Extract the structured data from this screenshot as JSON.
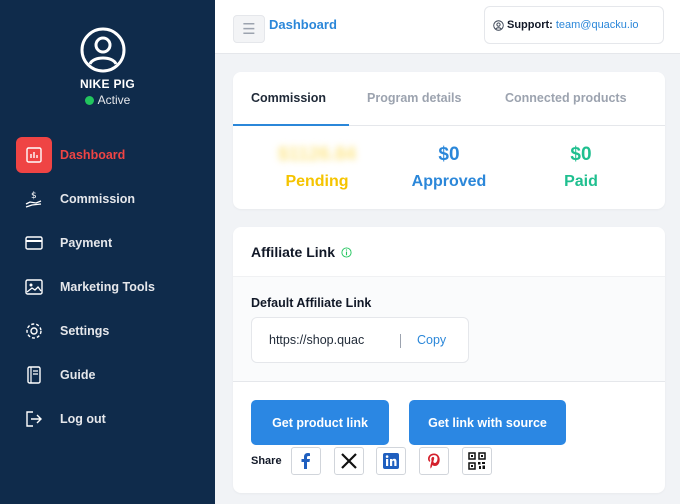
{
  "user": {
    "name": "NIKE PIG",
    "status": "Active"
  },
  "nav": [
    {
      "label": "Dashboard",
      "icon": "chart-bar-icon",
      "active": true
    },
    {
      "label": "Commission",
      "icon": "money-hand-icon"
    },
    {
      "label": "Payment",
      "icon": "credit-card-icon"
    },
    {
      "label": "Marketing Tools",
      "icon": "image-icon"
    },
    {
      "label": "Settings",
      "icon": "gear-icon"
    },
    {
      "label": "Guide",
      "icon": "book-icon"
    },
    {
      "label": "Log out",
      "icon": "logout-icon"
    }
  ],
  "topbar": {
    "title": "Dashboard",
    "menu_icon": "hamburger-icon",
    "support_label": "Support:",
    "support_email": "team@quacku.io"
  },
  "tabs": [
    {
      "label": "Commission",
      "active": true
    },
    {
      "label": "Program details"
    },
    {
      "label": "Connected products"
    }
  ],
  "stats": [
    {
      "value": "$1126.84",
      "label": "Pending",
      "color": "#f5c400",
      "blurred": true
    },
    {
      "value": "$0",
      "label": "Approved",
      "color": "#2b87d9"
    },
    {
      "value": "$0",
      "label": "Paid",
      "color": "#1fbf8f"
    }
  ],
  "affiliate": {
    "title": "Affiliate Link",
    "default_label": "Default Affiliate Link",
    "url": "https://shop.quac",
    "copy_label": "Copy",
    "buttons": [
      "Get product link",
      "Get link with source"
    ],
    "share_label": "Share",
    "share_icons": [
      "facebook-icon",
      "x-twitter-icon",
      "linkedin-icon",
      "pinterest-icon",
      "qr-code-icon"
    ]
  },
  "colors": {
    "sidebar_bg": "#0f2b4b",
    "accent_red": "#ef4444",
    "accent_blue": "#2b87d9",
    "pending_yellow": "#f5c400",
    "paid_green": "#1fbf8f"
  }
}
